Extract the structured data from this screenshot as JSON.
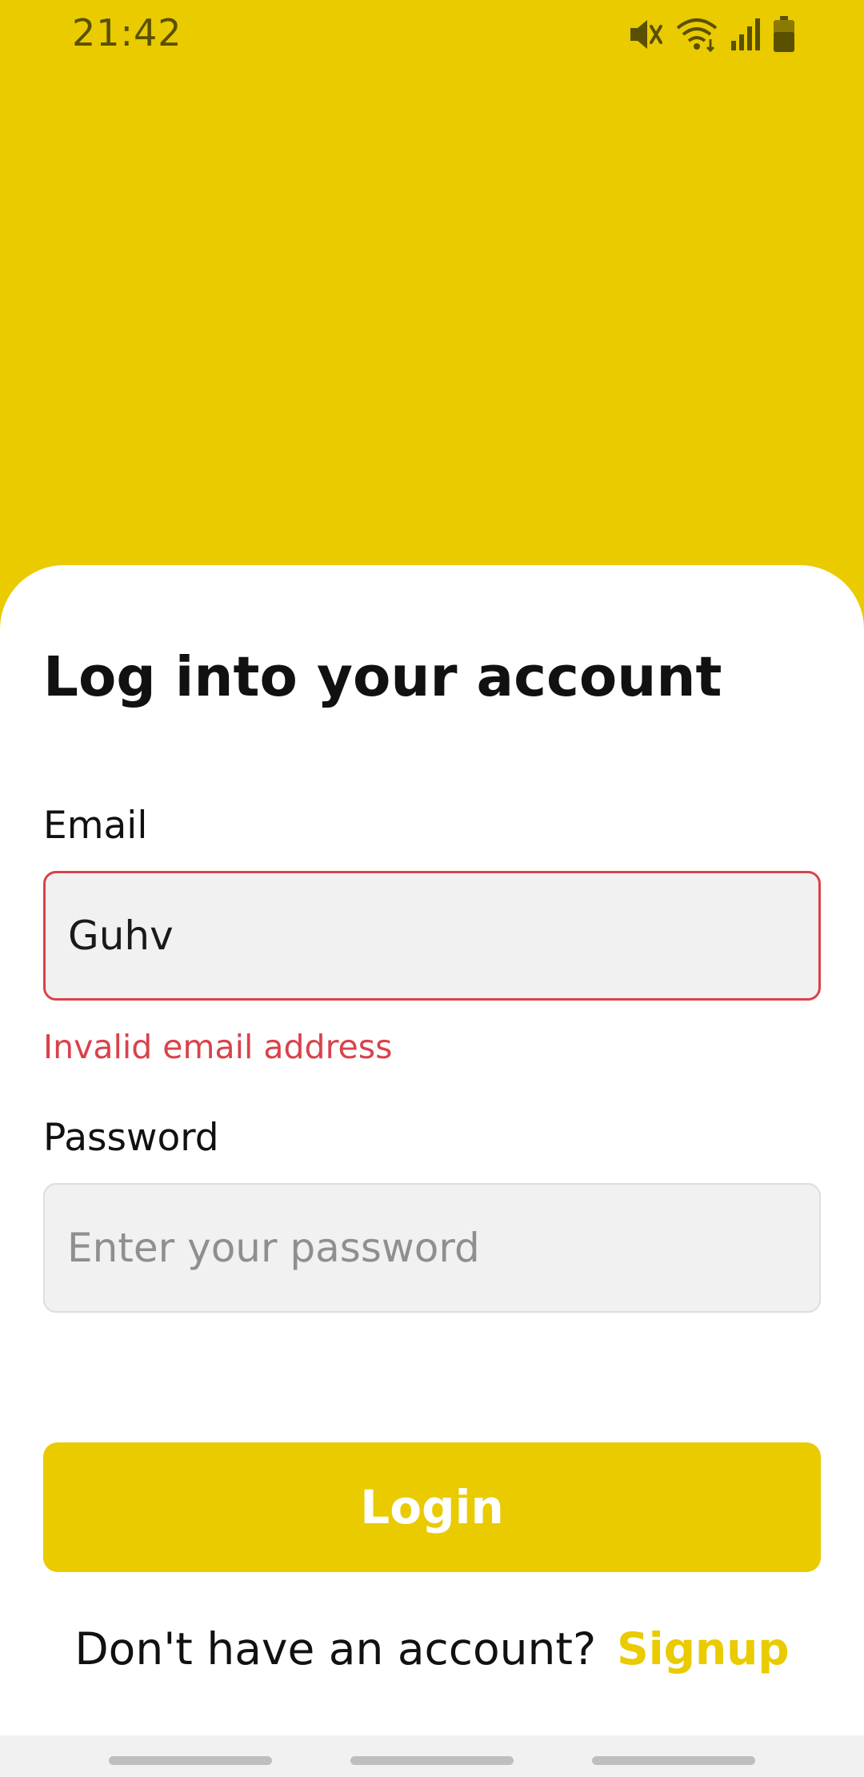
{
  "status_bar": {
    "time": "21:42",
    "icons": [
      "mute-icon",
      "wifi-icon",
      "signal-icon",
      "battery-icon"
    ]
  },
  "login": {
    "title": "Log into your account",
    "email": {
      "label": "Email",
      "value": "Guhv",
      "error": "Invalid email address"
    },
    "password": {
      "label": "Password",
      "placeholder": "Enter your password",
      "value": ""
    },
    "login_button": "Login",
    "signup_prompt": "Don't have an account?",
    "signup_link": "Signup"
  },
  "colors": {
    "brand": "#E9CB00",
    "error": "#D9424B",
    "input_background": "#F1F1F1",
    "text": "#111111"
  }
}
